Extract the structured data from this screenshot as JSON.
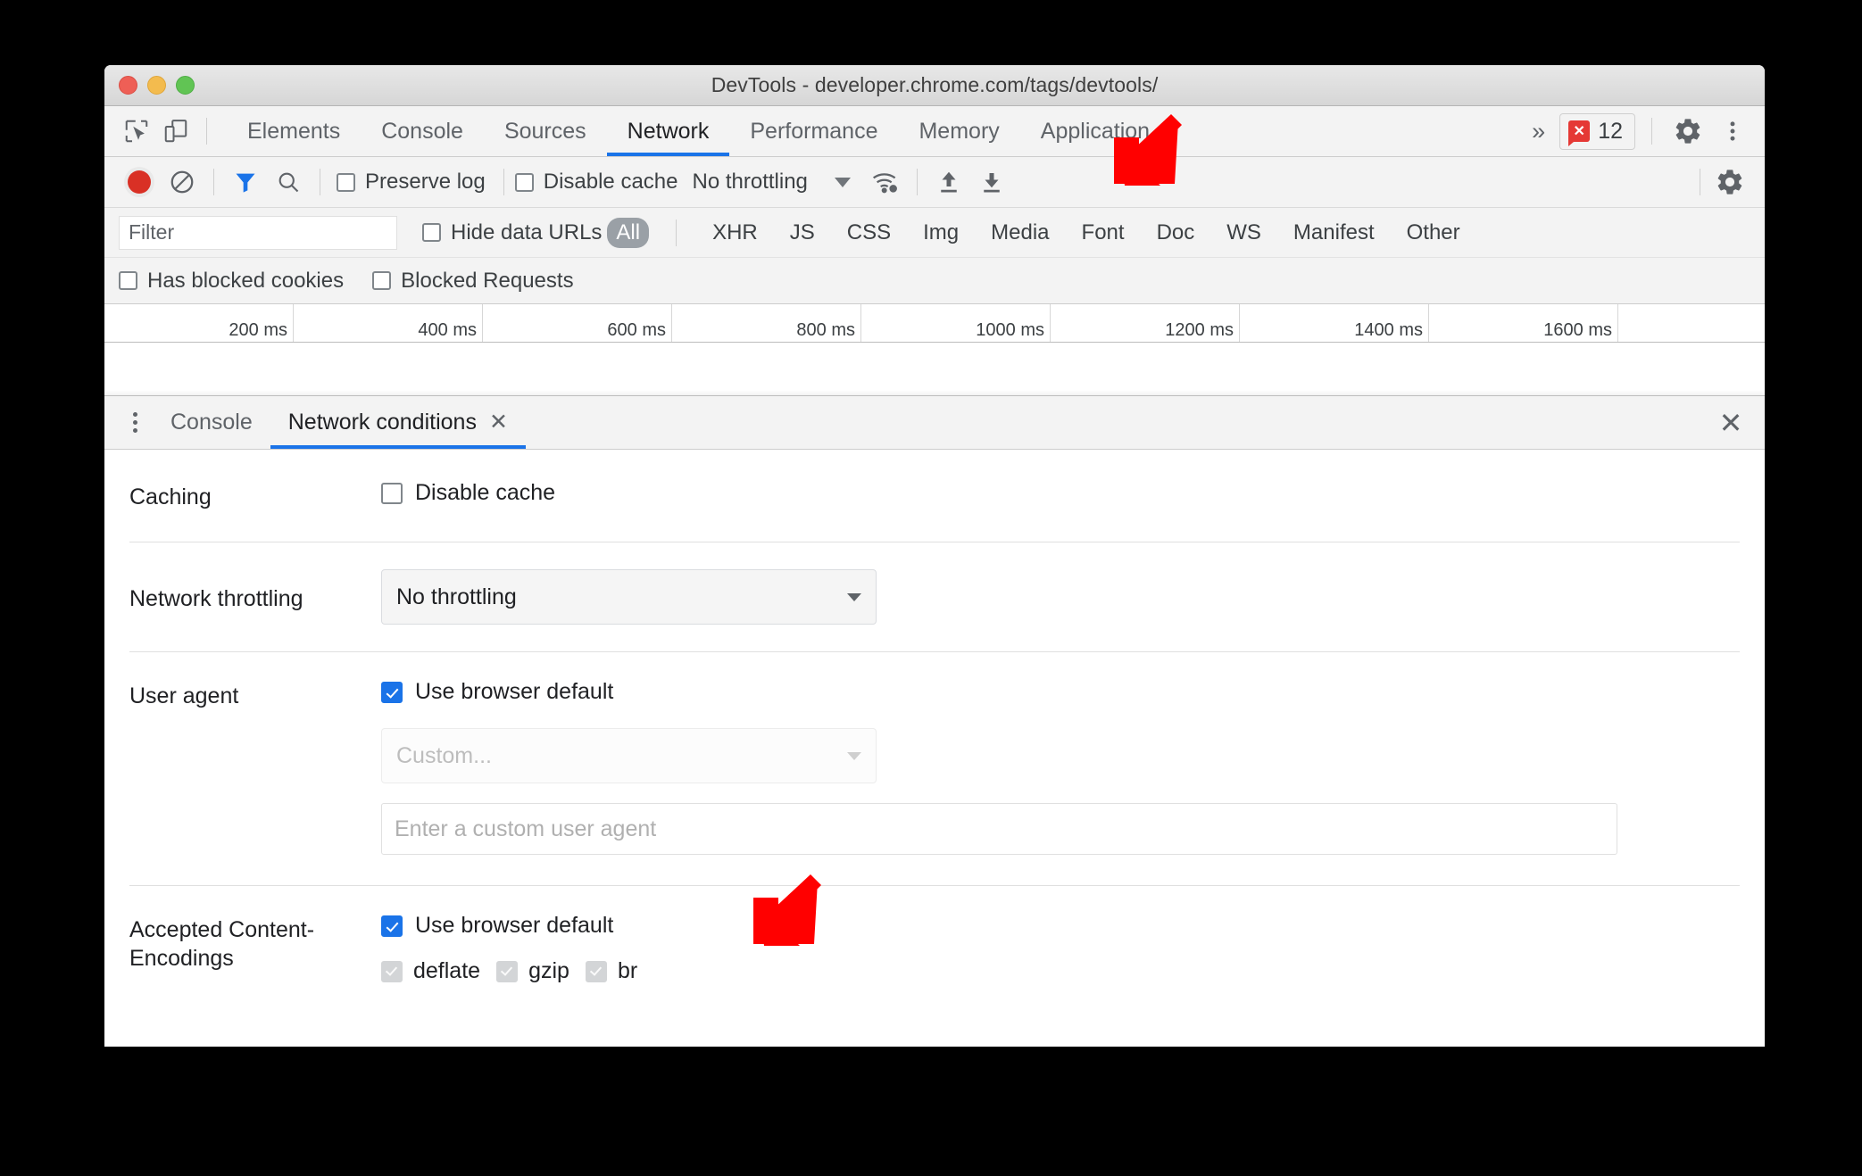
{
  "window": {
    "title": "DevTools - developer.chrome.com/tags/devtools/",
    "traffic_lights": [
      "close",
      "minimize",
      "maximize"
    ]
  },
  "tabbar": {
    "left_icons": [
      {
        "name": "inspect-element-icon",
        "label": "Inspect element"
      },
      {
        "name": "device-toolbar-icon",
        "label": "Toggle device toolbar"
      }
    ],
    "tabs": [
      {
        "label": "Elements",
        "active": false
      },
      {
        "label": "Console",
        "active": false
      },
      {
        "label": "Sources",
        "active": false
      },
      {
        "label": "Network",
        "active": true
      },
      {
        "label": "Performance",
        "active": false
      },
      {
        "label": "Memory",
        "active": false
      },
      {
        "label": "Application",
        "active": false
      }
    ],
    "more_tabs_label": "»",
    "error_count": "12",
    "error_icon_glyph": "✕",
    "settings_icon": "gear-icon",
    "more_icon": "kebab-menu-icon"
  },
  "network_toolbar": {
    "record_label": "Record",
    "clear_label": "Clear",
    "filter_label": "Filter",
    "search_label": "Search",
    "preserve_log": {
      "label": "Preserve log",
      "checked": false
    },
    "disable_cache": {
      "label": "Disable cache",
      "checked": false
    },
    "throttling_value": "No throttling",
    "wifi_icon": "network-conditions-icon",
    "import_icon": "upload-har-icon",
    "export_icon": "download-har-icon",
    "settings_icon": "gear-icon"
  },
  "filter_row": {
    "filter_placeholder": "Filter",
    "filter_value": "",
    "hide_data_urls": {
      "label": "Hide data URLs",
      "checked": false
    },
    "types": [
      {
        "label": "All",
        "selected": true
      },
      {
        "label": "XHR",
        "selected": false
      },
      {
        "label": "JS",
        "selected": false
      },
      {
        "label": "CSS",
        "selected": false
      },
      {
        "label": "Img",
        "selected": false
      },
      {
        "label": "Media",
        "selected": false
      },
      {
        "label": "Font",
        "selected": false
      },
      {
        "label": "Doc",
        "selected": false
      },
      {
        "label": "WS",
        "selected": false
      },
      {
        "label": "Manifest",
        "selected": false
      },
      {
        "label": "Other",
        "selected": false
      }
    ]
  },
  "blocked_row": {
    "has_blocked_cookies": {
      "label": "Has blocked cookies",
      "checked": false
    },
    "blocked_requests": {
      "label": "Blocked Requests",
      "checked": false
    }
  },
  "timeline_ruler": {
    "ticks": [
      "200 ms",
      "400 ms",
      "600 ms",
      "800 ms",
      "1000 ms",
      "1200 ms",
      "1400 ms",
      "1600 ms"
    ]
  },
  "drawer": {
    "tabs": [
      {
        "label": "Console",
        "active": false,
        "closable": false
      },
      {
        "label": "Network conditions",
        "active": true,
        "closable": true,
        "close_glyph": "✕"
      }
    ],
    "close_glyph": "✕"
  },
  "network_conditions": {
    "caching": {
      "label": "Caching",
      "disable_cache": {
        "label": "Disable cache",
        "checked": false
      }
    },
    "throttling": {
      "label": "Network throttling",
      "selected": "No throttling"
    },
    "user_agent": {
      "label": "User agent",
      "use_browser_default": {
        "label": "Use browser default",
        "checked": true
      },
      "preset_placeholder": "Custom...",
      "custom_placeholder": "Enter a custom user agent",
      "custom_value": ""
    },
    "content_encodings": {
      "label": "Accepted Content-Encodings",
      "use_browser_default": {
        "label": "Use browser default",
        "checked": true
      },
      "options": [
        {
          "label": "deflate",
          "checked": true,
          "disabled": true
        },
        {
          "label": "gzip",
          "checked": true,
          "disabled": true
        },
        {
          "label": "br",
          "checked": true,
          "disabled": true
        }
      ]
    }
  },
  "annotations": {
    "arrows": [
      {
        "name": "arrow-network-conditions-icon",
        "color": "#FF0000"
      },
      {
        "name": "arrow-content-encodings",
        "color": "#FF0000"
      }
    ],
    "color": "#FF0000"
  },
  "colors": {
    "accent": "#1a73e8",
    "error": "#e53935",
    "annotation": "#FF0000",
    "toolbar_bg": "#f3f3f3",
    "text": "#202124"
  }
}
